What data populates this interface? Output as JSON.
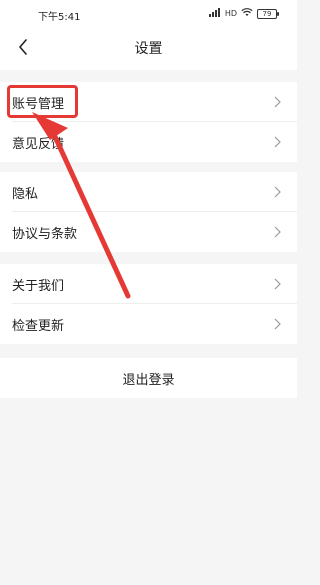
{
  "status_bar": {
    "time": "下午5:41",
    "signal_text": "HD",
    "battery": "79",
    "icons": [
      "signal-icon",
      "wifi-icon",
      "battery-icon"
    ]
  },
  "header": {
    "title": "设置",
    "back_icon": "chevron-left-icon"
  },
  "groups": [
    {
      "items": [
        {
          "label": "账号管理"
        },
        {
          "label": "意见反馈"
        }
      ]
    },
    {
      "items": [
        {
          "label": "隐私"
        },
        {
          "label": "协议与条款"
        }
      ]
    },
    {
      "items": [
        {
          "label": "关于我们"
        },
        {
          "label": "检查更新"
        }
      ]
    }
  ],
  "logout": {
    "label": "退出登录"
  },
  "colors": {
    "annotation": "#e53935",
    "background": "#f5f5f5",
    "surface": "#ffffff"
  }
}
